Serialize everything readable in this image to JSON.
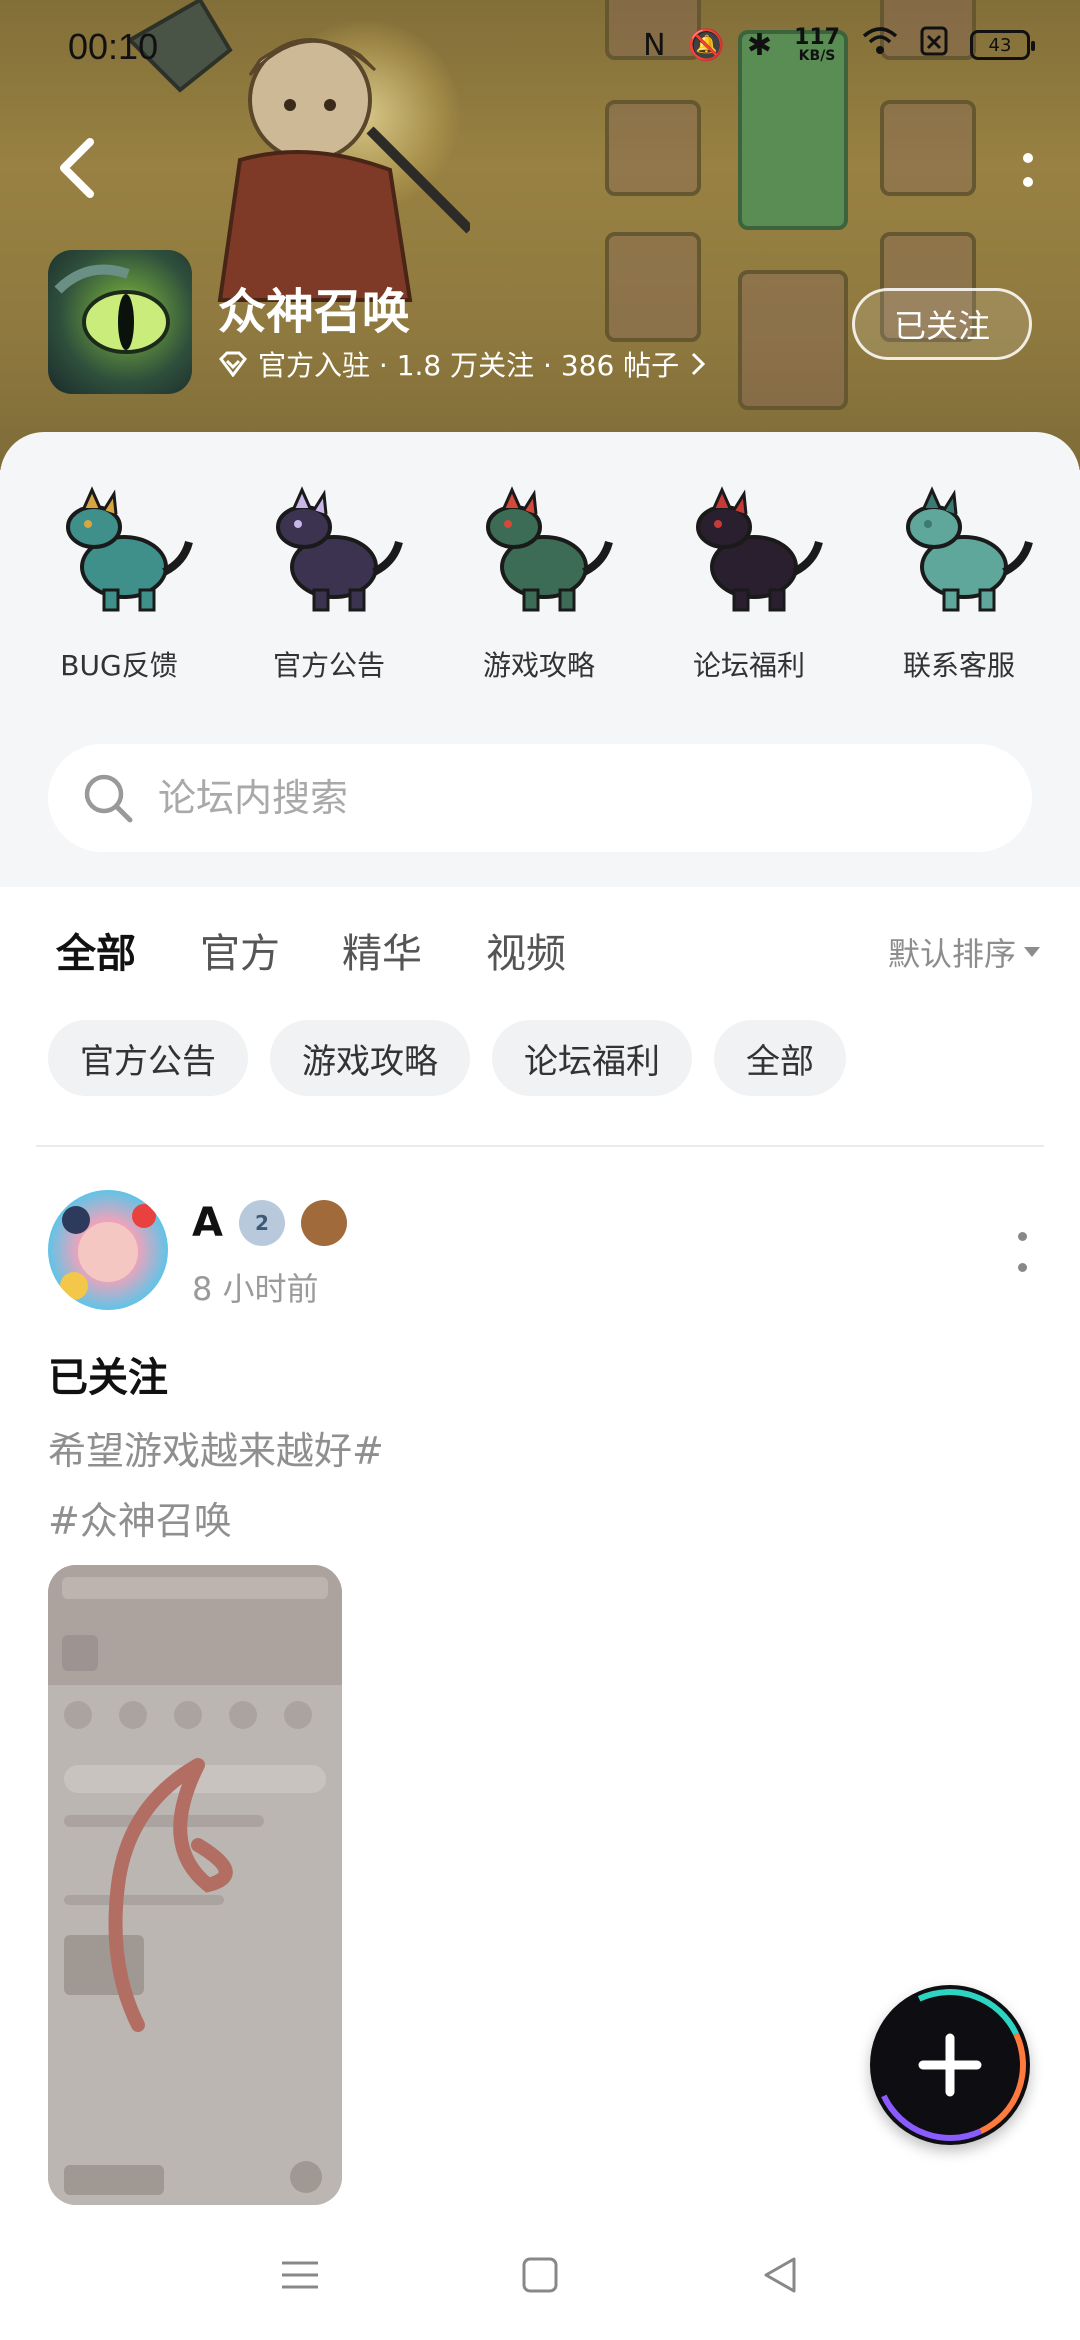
{
  "status_bar": {
    "time": "00:10",
    "net_speed_value": "117",
    "net_speed_unit": "KB/S",
    "battery": "43"
  },
  "header": {
    "title": "众神召唤",
    "meta": "官方入驻 · 1.8 万关注 · 386 帖子",
    "follow_label": "已关注"
  },
  "shortcuts": [
    {
      "label": "BUG反馈",
      "color": "#3f8f8a",
      "accent": "#d6a642"
    },
    {
      "label": "官方公告",
      "color": "#3b3350",
      "accent": "#c9b6e8"
    },
    {
      "label": "游戏攻略",
      "color": "#3c6c55",
      "accent": "#d34a3a"
    },
    {
      "label": "论坛福利",
      "color": "#2a1f2f",
      "accent": "#c83a3a"
    },
    {
      "label": "联系客服",
      "color": "#5fa79a",
      "accent": "#3b7a72"
    }
  ],
  "search": {
    "placeholder": "论坛内搜索"
  },
  "tabs": [
    {
      "label": "全部",
      "active": true
    },
    {
      "label": "官方",
      "active": false
    },
    {
      "label": "精华",
      "active": false
    },
    {
      "label": "视频",
      "active": false
    }
  ],
  "sort_label": "默认排序",
  "chips": [
    "官方公告",
    "游戏攻略",
    "论坛福利",
    "全部"
  ],
  "post": {
    "author": "A",
    "level_badge": "2",
    "time": "8 小时前",
    "title": "已关注",
    "text_line1": "希望游戏越来越好#",
    "text_line2": "#众神召唤"
  },
  "colors": {
    "accent": "#2cd4c1",
    "hero_bg": "#a8904a",
    "panel_bg": "#f5f6f8"
  }
}
